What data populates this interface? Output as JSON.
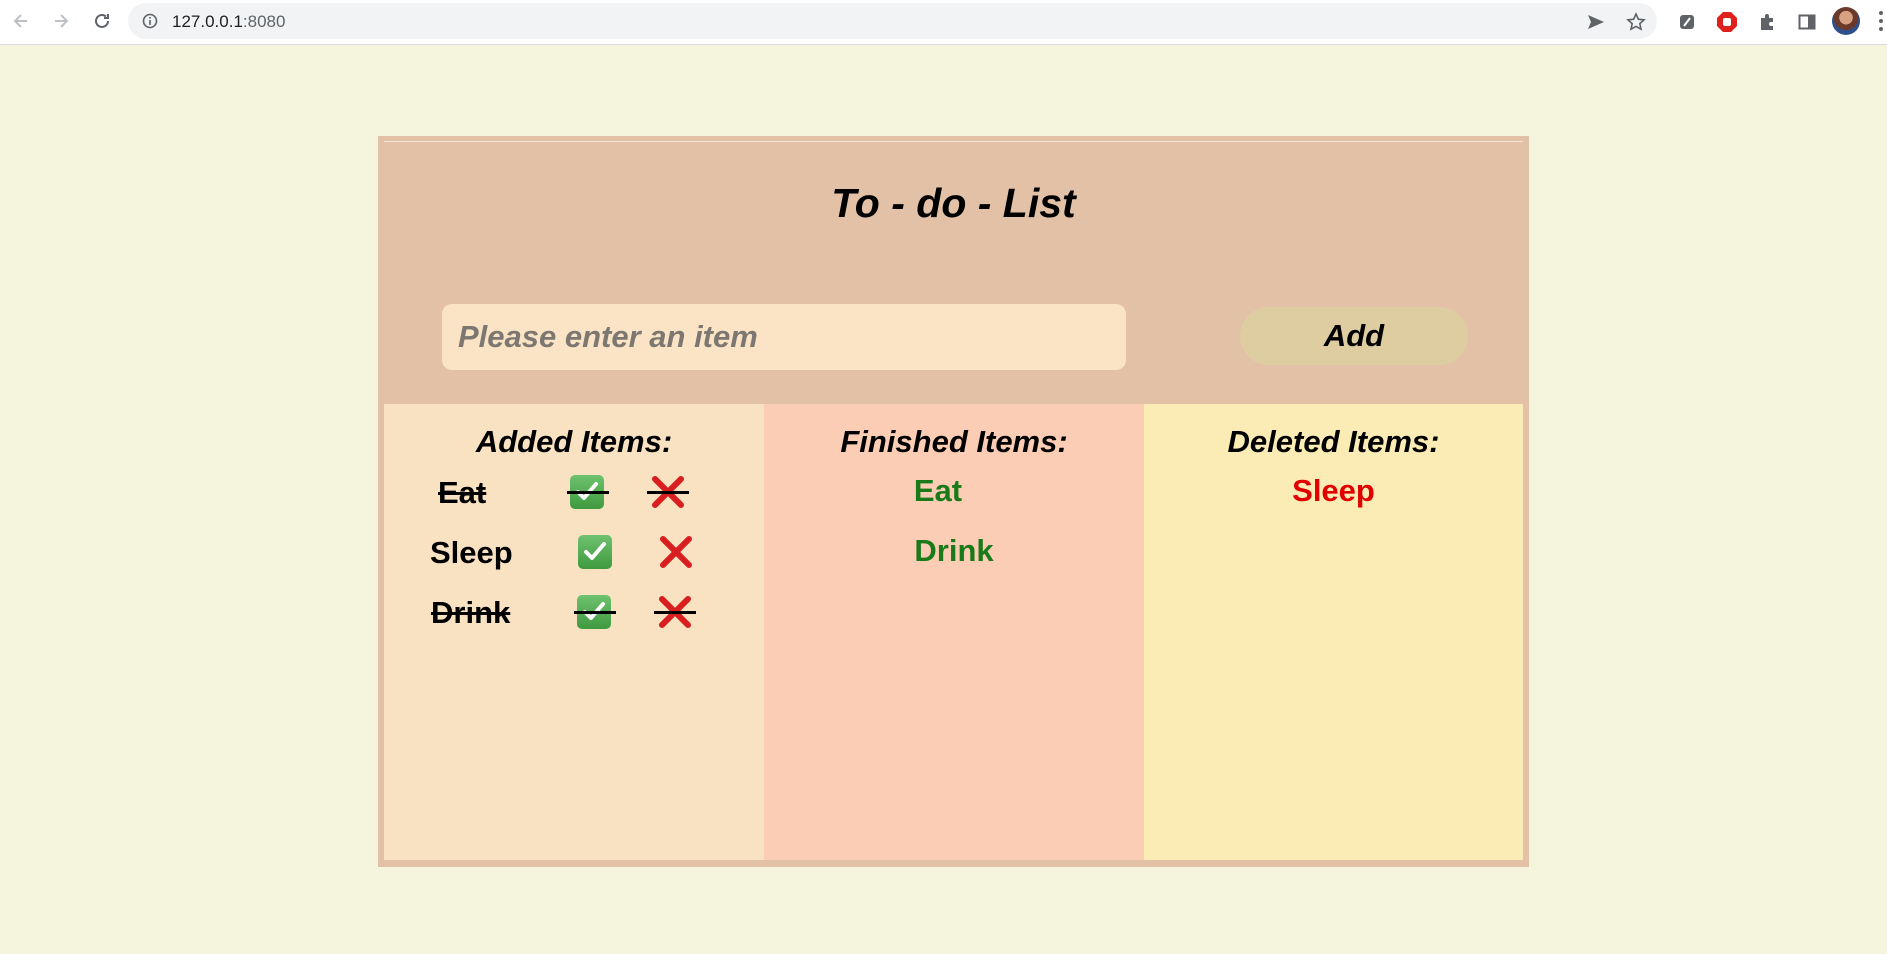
{
  "browser": {
    "url_host": "127.0.0.1",
    "url_port": ":8080"
  },
  "app": {
    "title": "To - do - List",
    "input_placeholder": "Please enter an item",
    "add_label": "Add",
    "columns": {
      "added_heading": "Added Items:",
      "finished_heading": "Finished Items:",
      "deleted_heading": "Deleted Items:"
    },
    "added_items": [
      {
        "label": "Eat",
        "struck": true
      },
      {
        "label": "Sleep",
        "struck": false
      },
      {
        "label": "Drink",
        "struck": true
      }
    ],
    "finished_items": [
      "Eat",
      "Drink"
    ],
    "deleted_items": [
      "Sleep"
    ],
    "colors": {
      "page_bg": "#f5f4dc",
      "panel_bg": "#e2c1a6",
      "added_bg": "#f9e2c2",
      "finished_bg": "#fbcdb5",
      "deleted_bg": "#fbecb5",
      "finished_text": "#1a7a1a",
      "deleted_text": "#e00000"
    },
    "icons": {
      "finish": "check-mark-button-icon",
      "delete": "cross-mark-icon"
    }
  }
}
